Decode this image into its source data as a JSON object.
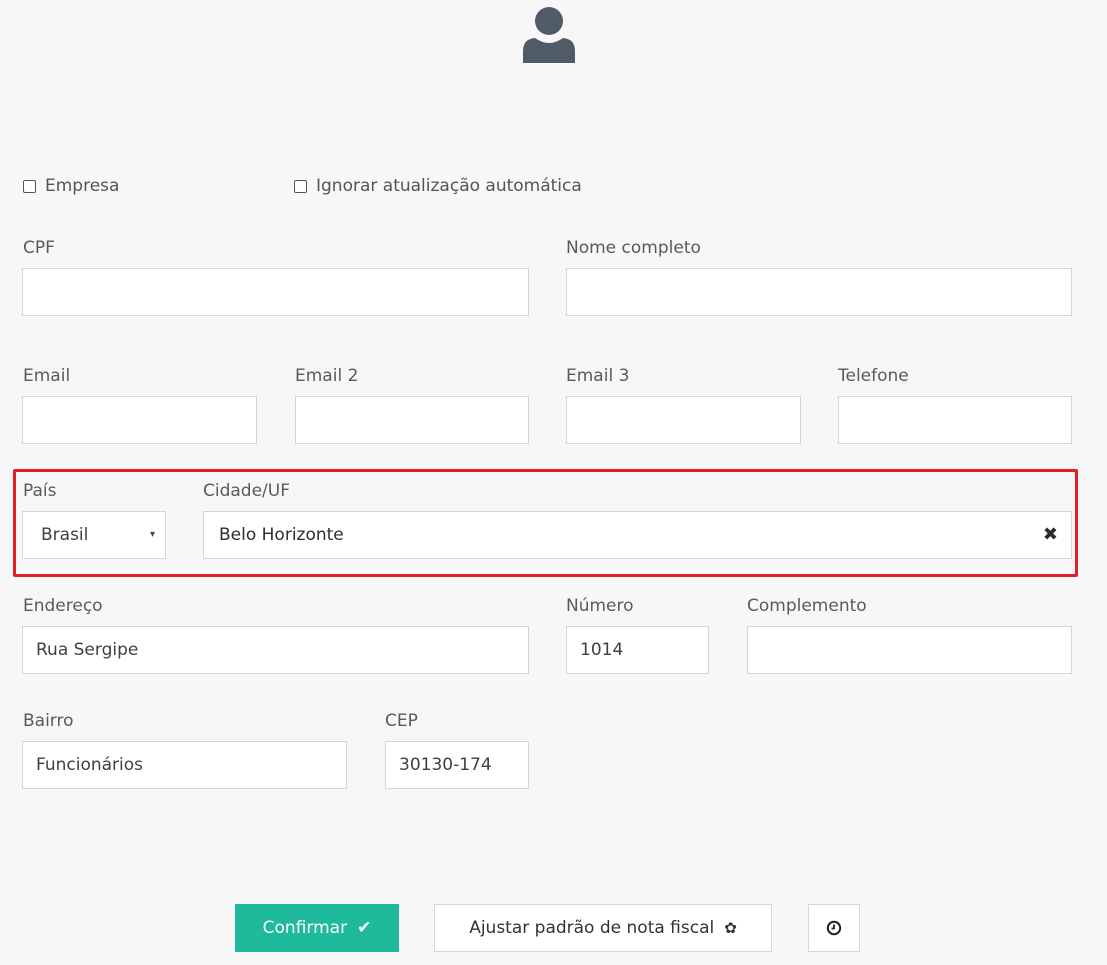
{
  "icons": {
    "avatar": "user-icon",
    "select_arrow": "▾",
    "clear": "✖",
    "confirm": "✔",
    "settings": "✿",
    "history": "clock-icon"
  },
  "checkboxes": {
    "empresa": "Empresa",
    "ignorar": "Ignorar atualização automática"
  },
  "fields": {
    "cpf": {
      "label": "CPF",
      "value": ""
    },
    "nome": {
      "label": "Nome completo",
      "value": ""
    },
    "email": {
      "label": "Email",
      "value": ""
    },
    "email2": {
      "label": "Email 2",
      "value": ""
    },
    "email3": {
      "label": "Email 3",
      "value": ""
    },
    "telefone": {
      "label": "Telefone",
      "value": ""
    },
    "pais": {
      "label": "País",
      "value": "Brasil"
    },
    "cidade": {
      "label": "Cidade/UF",
      "value": "Belo Horizonte"
    },
    "endereco": {
      "label": "Endereço",
      "value": "Rua Sergipe"
    },
    "numero": {
      "label": "Número",
      "value": "1014"
    },
    "complemento": {
      "label": "Complemento",
      "value": ""
    },
    "bairro": {
      "label": "Bairro",
      "value": "Funcionários"
    },
    "cep": {
      "label": "CEP",
      "value": "30130-174"
    }
  },
  "buttons": {
    "confirm": "Confirmar",
    "fiscal": "Ajustar padrão de nota fiscal"
  },
  "colors": {
    "accent": "#1fb99c",
    "highlight": "#e41d2b",
    "avatar": "#4f5b66"
  }
}
